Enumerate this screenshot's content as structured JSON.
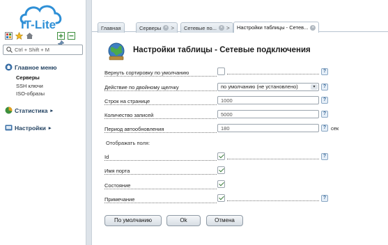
{
  "app": {
    "logo_text": "IT-Lite"
  },
  "sidebar": {
    "search_placeholder": "Ctrl + Shift + M",
    "sections": [
      {
        "label": "Главное меню",
        "icon": "home-icon",
        "items": [
          "Серверы",
          "SSH ключи",
          "ISO-образы"
        ]
      },
      {
        "label": "Статистика",
        "icon": "statistics-icon",
        "chevron": "▸"
      },
      {
        "label": "Настройки",
        "icon": "settings-icon",
        "chevron": "▸"
      }
    ],
    "active_item": "Серверы"
  },
  "tabs": [
    {
      "label": "Главная",
      "closable": false
    },
    {
      "label": "Серверы",
      "closable": true
    },
    {
      "label": "Сетевые по...",
      "closable": true
    },
    {
      "label": "Настройки таблицы - Сетев...",
      "closable": true,
      "active": true
    }
  ],
  "tab_separator": ">",
  "tab_close_glyph": "×",
  "page": {
    "title": "Настройки таблицы - Сетевые подключения",
    "fields": {
      "reset_sort": {
        "label": "Вернуть сортировку по умолчанию",
        "checked": false
      },
      "double_click": {
        "label": "Действие по двойному щелчку",
        "value": "по умолчанию (не установлено)"
      },
      "rows_per_page": {
        "label": "Строк на странице",
        "value": "1000"
      },
      "record_count": {
        "label": "Количество записей",
        "value": "5000"
      },
      "refresh_period": {
        "label": "Период автообновления",
        "value": "180",
        "unit": "сек"
      }
    },
    "display_fields_label": "Отображать поля:",
    "display_fields": [
      {
        "label": "Id",
        "checked": true
      },
      {
        "label": "Имя порта",
        "checked": true
      },
      {
        "label": "Состояние",
        "checked": true
      },
      {
        "label": "Примечание",
        "checked": true
      }
    ],
    "help_glyph": "?",
    "dropdown_glyph": "▾"
  },
  "buttons": {
    "default": "По умолчанию",
    "ok": "Ok",
    "cancel": "Отмена"
  },
  "colors": {
    "logo_cloud": "#2e8fd6",
    "logo_text": "#2e8fd6",
    "title_text": "#1f3f5f",
    "check_mark": "#3b7d3b"
  }
}
